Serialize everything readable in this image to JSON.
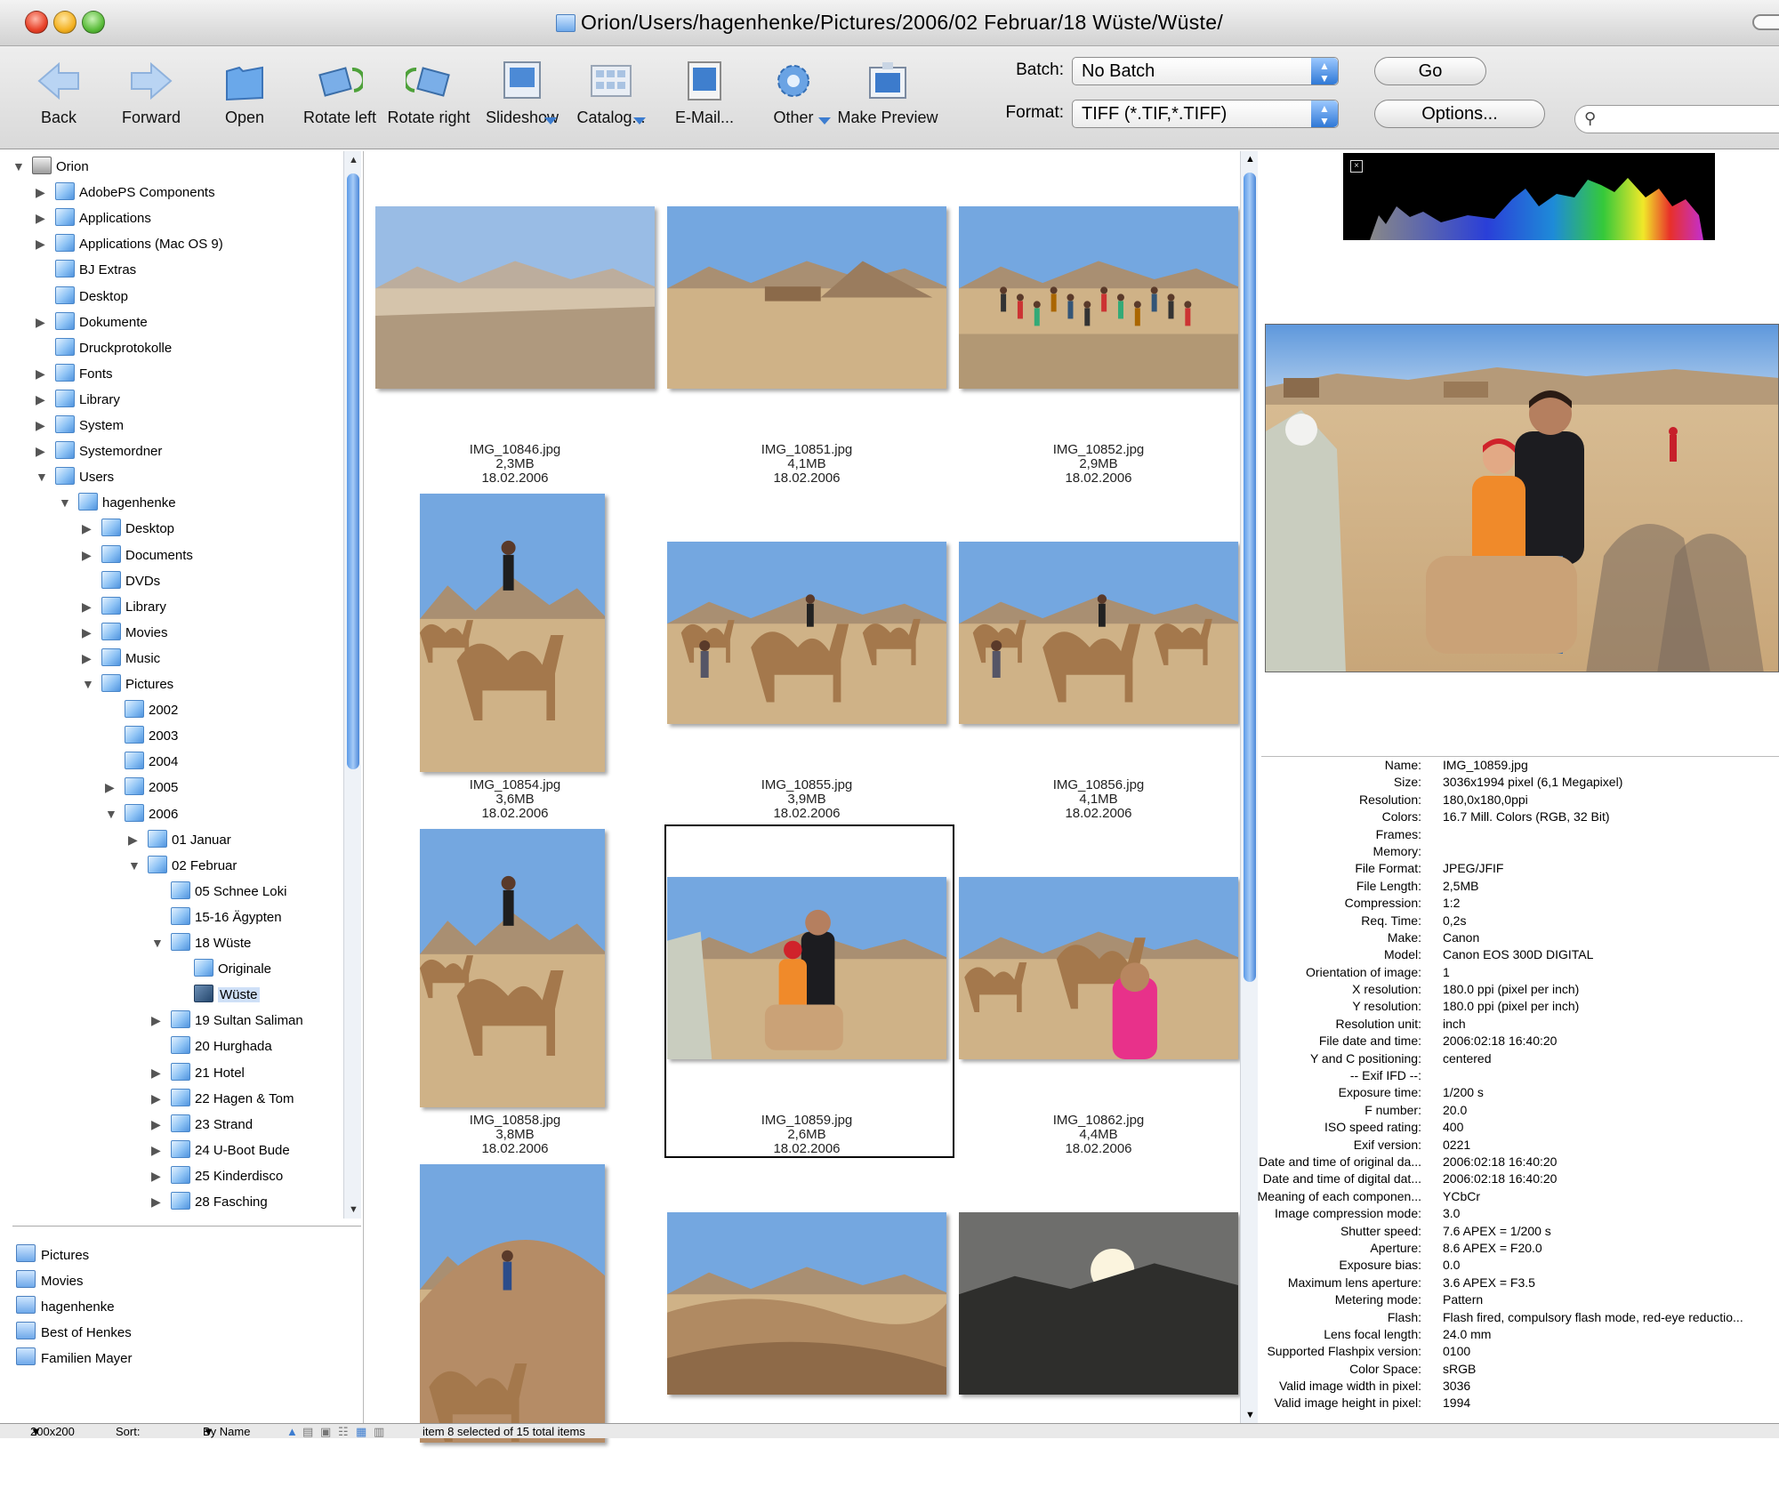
{
  "window": {
    "title": "Orion/Users/hagenhenke/Pictures/2006/02 Februar/18 Wüste/Wüste/"
  },
  "toolbar": {
    "back": "Back",
    "forward": "Forward",
    "open": "Open",
    "rotate_left": "Rotate left",
    "rotate_right": "Rotate right",
    "slideshow": "Slideshow",
    "catalog": "Catalog...",
    "email": "E-Mail...",
    "other": "Other",
    "make_preview": "Make Preview",
    "batch_label": "Batch:",
    "batch_value": "No Batch",
    "go": "Go",
    "format_label": "Format:",
    "format_value": "TIFF (*.TIF,*.TIFF)",
    "options": "Options..."
  },
  "tree": [
    {
      "label": "Orion",
      "depth": 0,
      "tri": "▼",
      "icon": "drive-icon"
    },
    {
      "label": "AdobePS Components",
      "depth": 1,
      "tri": "▶"
    },
    {
      "label": "Applications",
      "depth": 1,
      "tri": "▶"
    },
    {
      "label": "Applications (Mac OS 9)",
      "depth": 1,
      "tri": "▶"
    },
    {
      "label": "BJ Extras",
      "depth": 1,
      "tri": ""
    },
    {
      "label": "Desktop",
      "depth": 1,
      "tri": ""
    },
    {
      "label": "Dokumente",
      "depth": 1,
      "tri": "▶"
    },
    {
      "label": "Druckprotokolle",
      "depth": 1,
      "tri": ""
    },
    {
      "label": "Fonts",
      "depth": 1,
      "tri": "▶"
    },
    {
      "label": "Library",
      "depth": 1,
      "tri": "▶"
    },
    {
      "label": "System",
      "depth": 1,
      "tri": "▶"
    },
    {
      "label": "Systemordner",
      "depth": 1,
      "tri": "▶"
    },
    {
      "label": "Users",
      "depth": 1,
      "tri": "▼"
    },
    {
      "label": "hagenhenke",
      "depth": 2,
      "tri": "▼"
    },
    {
      "label": "Desktop",
      "depth": 3,
      "tri": "▶"
    },
    {
      "label": "Documents",
      "depth": 3,
      "tri": "▶"
    },
    {
      "label": "DVDs",
      "depth": 3,
      "tri": ""
    },
    {
      "label": "Library",
      "depth": 3,
      "tri": "▶"
    },
    {
      "label": "Movies",
      "depth": 3,
      "tri": "▶"
    },
    {
      "label": "Music",
      "depth": 3,
      "tri": "▶"
    },
    {
      "label": "Pictures",
      "depth": 3,
      "tri": "▼"
    },
    {
      "label": "2002",
      "depth": 4,
      "tri": ""
    },
    {
      "label": "2003",
      "depth": 4,
      "tri": ""
    },
    {
      "label": "2004",
      "depth": 4,
      "tri": ""
    },
    {
      "label": "2005",
      "depth": 4,
      "tri": "▶"
    },
    {
      "label": "2006",
      "depth": 4,
      "tri": "▼"
    },
    {
      "label": "01 Januar",
      "depth": 5,
      "tri": "▶"
    },
    {
      "label": "02 Februar",
      "depth": 5,
      "tri": "▼"
    },
    {
      "label": "05 Schnee Loki",
      "depth": 6,
      "tri": ""
    },
    {
      "label": "15-16 Ägypten",
      "depth": 6,
      "tri": ""
    },
    {
      "label": "18 Wüste",
      "depth": 6,
      "tri": "▼"
    },
    {
      "label": "Originale",
      "depth": 7,
      "tri": ""
    },
    {
      "label": "Wüste",
      "depth": 7,
      "tri": "",
      "selected": true
    },
    {
      "label": "19 Sultan Saliman",
      "depth": 6,
      "tri": "▶"
    },
    {
      "label": "20 Hurghada",
      "depth": 6,
      "tri": ""
    },
    {
      "label": "21 Hotel",
      "depth": 6,
      "tri": "▶"
    },
    {
      "label": "22 Hagen & Tom",
      "depth": 6,
      "tri": "▶"
    },
    {
      "label": "23 Strand",
      "depth": 6,
      "tri": "▶"
    },
    {
      "label": "24 U-Boot Bude",
      "depth": 6,
      "tri": "▶"
    },
    {
      "label": "25 Kinderdisco",
      "depth": 6,
      "tri": "▶"
    },
    {
      "label": "28 Fasching",
      "depth": 6,
      "tri": "▶"
    }
  ],
  "favorites": [
    "Pictures",
    "Movies",
    "hagenhenke",
    "Best of Henkes",
    "Familien Mayer"
  ],
  "thumbnails": [
    {
      "name": "IMG_10846.jpg",
      "size": "2,3MB",
      "date": "18.02.2006",
      "orient": "landscape",
      "scene": "dust"
    },
    {
      "name": "IMG_10851.jpg",
      "size": "4,1MB",
      "date": "18.02.2006",
      "orient": "landscape",
      "scene": "village"
    },
    {
      "name": "IMG_10852.jpg",
      "size": "2,9MB",
      "date": "18.02.2006",
      "orient": "landscape",
      "scene": "crowd"
    },
    {
      "name": "IMG_10854.jpg",
      "size": "3,6MB",
      "date": "18.02.2006",
      "orient": "portrait",
      "scene": "camel"
    },
    {
      "name": "IMG_10855.jpg",
      "size": "3,9MB",
      "date": "18.02.2006",
      "orient": "landscape",
      "scene": "camels"
    },
    {
      "name": "IMG_10856.jpg",
      "size": "4,1MB",
      "date": "18.02.2006",
      "orient": "landscape",
      "scene": "camels"
    },
    {
      "name": "IMG_10858.jpg",
      "size": "3,8MB",
      "date": "18.02.2006",
      "orient": "portrait",
      "scene": "camel"
    },
    {
      "name": "IMG_10859.jpg",
      "size": "2,6MB",
      "date": "18.02.2006",
      "orient": "landscape",
      "scene": "people",
      "selected": true
    },
    {
      "name": "IMG_10862.jpg",
      "size": "4,4MB",
      "date": "18.02.2006",
      "orient": "landscape",
      "scene": "market"
    },
    {
      "name": "",
      "size": "",
      "date": "",
      "orient": "portrait",
      "scene": "hill"
    },
    {
      "name": "",
      "size": "",
      "date": "",
      "orient": "landscape",
      "scene": "dunes"
    },
    {
      "name": "",
      "size": "",
      "date": "",
      "orient": "landscape",
      "scene": "sunset"
    }
  ],
  "info": [
    [
      "Name:",
      "IMG_10859.jpg"
    ],
    [
      "Size:",
      "3036x1994 pixel (6,1 Megapixel)"
    ],
    [
      "Resolution:",
      "180,0x180,0ppi"
    ],
    [
      "Colors:",
      "16.7 Mill. Colors (RGB, 32 Bit)"
    ],
    [
      "Frames:",
      ""
    ],
    [
      "Memory:",
      ""
    ],
    [
      "File Format:",
      "JPEG/JFIF"
    ],
    [
      "File Length:",
      "2,5MB"
    ],
    [
      "Compression:",
      "1:2"
    ],
    [
      "Req. Time:",
      "0,2s"
    ],
    [
      "Make:",
      "Canon"
    ],
    [
      "Model:",
      "Canon EOS 300D DIGITAL"
    ],
    [
      "Orientation of image:",
      "1"
    ],
    [
      "X resolution:",
      "180.0 ppi (pixel per inch)"
    ],
    [
      "Y resolution:",
      "180.0 ppi (pixel per inch)"
    ],
    [
      "Resolution unit:",
      "inch"
    ],
    [
      "File date and time:",
      "2006:02:18 16:40:20"
    ],
    [
      "Y and C positioning:",
      "centered"
    ],
    [
      "-- Exif IFD --:",
      ""
    ],
    [
      "Exposure time:",
      "1/200 s"
    ],
    [
      "F number:",
      "20.0"
    ],
    [
      "ISO speed rating:",
      "400"
    ],
    [
      "Exif version:",
      "0221"
    ],
    [
      "Date and time of original da...",
      "2006:02:18 16:40:20"
    ],
    [
      "Date and time of digital dat...",
      "2006:02:18 16:40:20"
    ],
    [
      "Meaning of each componen...",
      "YCbCr"
    ],
    [
      "Image compression mode:",
      "3.0"
    ],
    [
      "Shutter speed:",
      "7.6 APEX = 1/200 s"
    ],
    [
      "Aperture:",
      "8.6 APEX = F20.0"
    ],
    [
      "Exposure bias:",
      "0.0"
    ],
    [
      "Maximum lens aperture:",
      "3.6 APEX = F3.5"
    ],
    [
      "Metering mode:",
      "Pattern"
    ],
    [
      "Flash:",
      "Flash fired, compulsory flash mode, red-eye reductio..."
    ],
    [
      "Lens focal length:",
      "24.0 mm"
    ],
    [
      "Supported Flashpix version:",
      "0100"
    ],
    [
      "Color Space:",
      "sRGB"
    ],
    [
      "Valid image width in pixel:",
      "3036"
    ],
    [
      "Valid image height in pixel:",
      "1994"
    ]
  ],
  "status": {
    "thumb_size": "200x200",
    "sort_label": "Sort:",
    "sort_value": "By Name",
    "selection": "item 8 selected of 15 total items"
  },
  "colors": {
    "accent": "#3d7dd0",
    "sky": "#6fa3de",
    "sand": "#d9bf97"
  }
}
